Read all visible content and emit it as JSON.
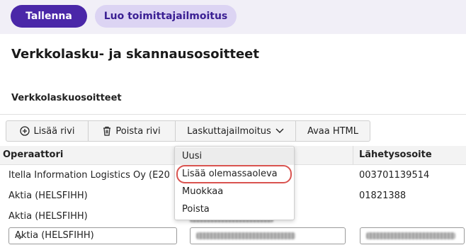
{
  "toolbar_top": {
    "save_label": "Tallenna",
    "supplier_notice_label": "Luo toimittajailmoitus"
  },
  "page": {
    "title": "Verkkolasku- ja skannausosoitteet",
    "section_title": "Verkkolaskuosoitteet"
  },
  "grid_toolbar": {
    "add_row": "Lisää rivi",
    "remove_row": "Poista rivi",
    "invoicer_notice": "Laskuttajailmoitus",
    "open_html": "Avaa HTML"
  },
  "table": {
    "headers": {
      "operator": "Operaattori",
      "sender_address": "Lähetysosoite"
    },
    "rows": [
      {
        "operator": "Itella Information Logistics Oy (E20",
        "sender_address": "003701139514"
      },
      {
        "operator": "Aktia (HELSFIHH)",
        "sender_address": "01821388"
      },
      {
        "operator": "Aktia (HELSFIHH)",
        "sender_address": ""
      }
    ],
    "edit_row": {
      "operator_selected": "Aktia (HELSFIHH)"
    }
  },
  "dropdown": {
    "items": [
      "Uusi",
      "Lisää olemassaoleva",
      "Muokkaa",
      "Poista"
    ]
  },
  "colors": {
    "primary": "#4a27a8",
    "secondary_bg": "#dcd4f3",
    "highlight_ring": "#d9534f"
  }
}
